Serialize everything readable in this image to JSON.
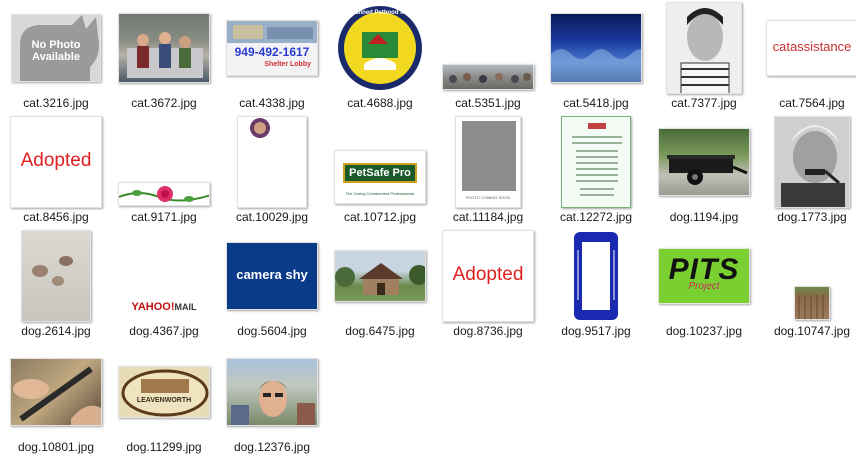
{
  "files": [
    {
      "name": "cat.3216.jpg"
    },
    {
      "name": "cat.3672.jpg"
    },
    {
      "name": "cat.4338.jpg",
      "text": "949-492-1617",
      "subtext": "Shelter Lobby"
    },
    {
      "name": "cat.4688.jpg",
      "text": "Planned Pethood Inc."
    },
    {
      "name": "cat.5351.jpg"
    },
    {
      "name": "cat.5418.jpg"
    },
    {
      "name": "cat.7377.jpg"
    },
    {
      "name": "cat.7564.jpg",
      "text": "catassistance"
    },
    {
      "name": "cat.8456.jpg",
      "text": "Adopted"
    },
    {
      "name": "cat.9171.jpg"
    },
    {
      "name": "cat.10029.jpg"
    },
    {
      "name": "cat.10712.jpg",
      "text": "PetSafe Pro",
      "subtext": "The Caring Containment Professionals"
    },
    {
      "name": "cat.11184.jpg",
      "subtext": "PHOTO COMING SOON"
    },
    {
      "name": "cat.12272.jpg"
    },
    {
      "name": "dog.1194.jpg"
    },
    {
      "name": "dog.1773.jpg"
    },
    {
      "name": "dog.2614.jpg"
    },
    {
      "name": "dog.4367.jpg",
      "text": "YAHOO!",
      "subtext": "MAIL"
    },
    {
      "name": "dog.5604.jpg",
      "text": "camera shy"
    },
    {
      "name": "dog.6475.jpg"
    },
    {
      "name": "dog.8736.jpg",
      "text": "Adopted"
    },
    {
      "name": "dog.9517.jpg"
    },
    {
      "name": "dog.10237.jpg",
      "text": "PITS",
      "subtext": "Project"
    },
    {
      "name": "dog.10747.jpg"
    },
    {
      "name": "dog.10801.jpg"
    },
    {
      "name": "dog.11299.jpg",
      "text": "LEAVENWORTH"
    },
    {
      "name": "dog.12376.jpg"
    }
  ],
  "placeholder": {
    "line1": "No Photo",
    "line2": "Available"
  }
}
